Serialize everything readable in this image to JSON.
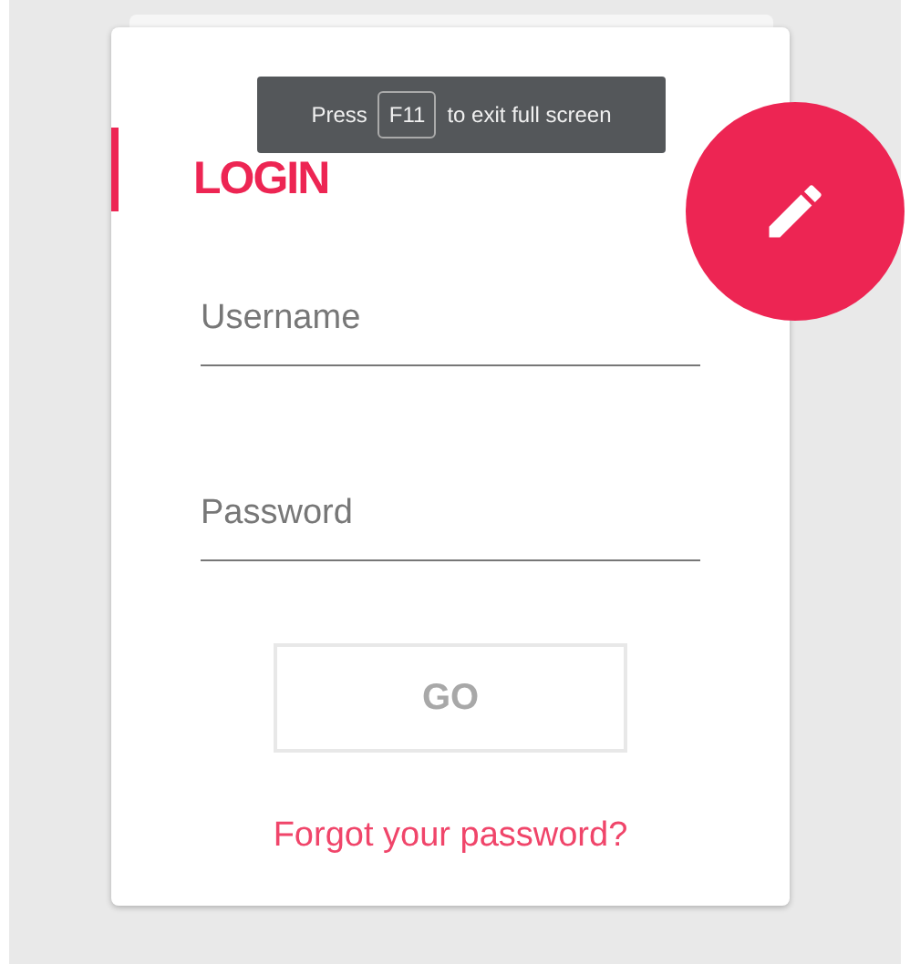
{
  "title": "LOGIN",
  "fields": [
    {
      "placeholder": "Username"
    },
    {
      "placeholder": "Password"
    }
  ],
  "submit": {
    "label": "GO",
    "disabled": true
  },
  "link": "Forgot your password?",
  "fullscreen_notice": {
    "before": "Press",
    "key": "F11",
    "after": "to exit full screen"
  }
}
